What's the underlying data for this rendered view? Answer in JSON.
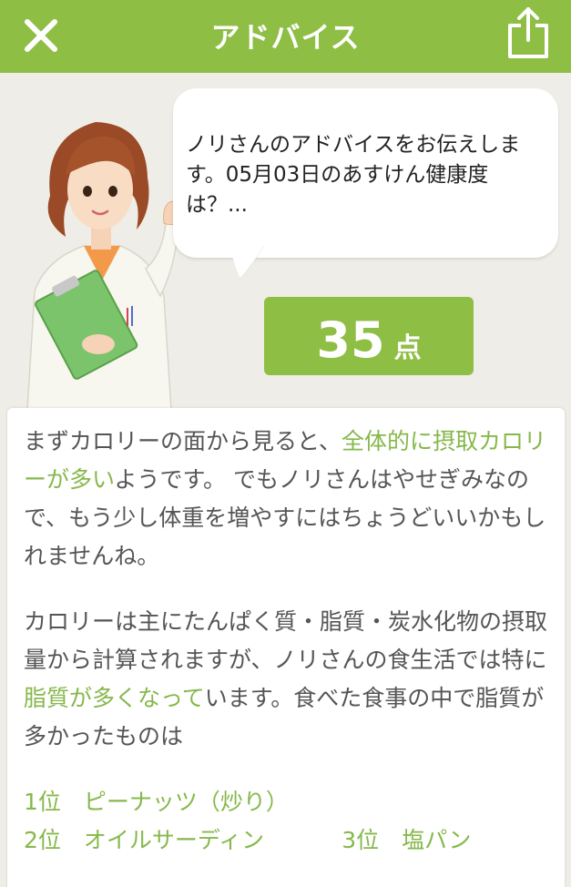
{
  "header": {
    "title": "アドバイス",
    "close_icon": "close-icon",
    "share_icon": "share-icon"
  },
  "bubble": {
    "text": "ノリさんのアドバイスをお伝えします。05月03日のあすけん健康度は？..."
  },
  "score": {
    "value": "35",
    "unit": "点"
  },
  "advice": {
    "p1_a": "まずカロリーの面から見ると、",
    "p1_hl": "全体的に摂取カロリーが多い",
    "p1_b": "ようです。 でもノリさんはやせぎみなので、もう少し体重を増やすにはちょうどいいかもしれませんね。",
    "p2_a": "カロリーは主にたんぱく質・脂質・炭水化物の摂取量から計算されますが、ノリさんの食生活では特に",
    "p2_hl": "脂質が多くなって",
    "p2_b": "います。食べた食事の中で脂質が多かったものは",
    "ranking": [
      {
        "rank": "1位",
        "food": "ピーナッツ（炒り）"
      },
      {
        "rank": "2位",
        "food": "オイルサーディン"
      },
      {
        "rank": "3位",
        "food": "塩パン"
      }
    ]
  },
  "colors": {
    "brand_green": "#8fbe45",
    "highlight_green": "#86b84b",
    "background": "#efede7"
  }
}
